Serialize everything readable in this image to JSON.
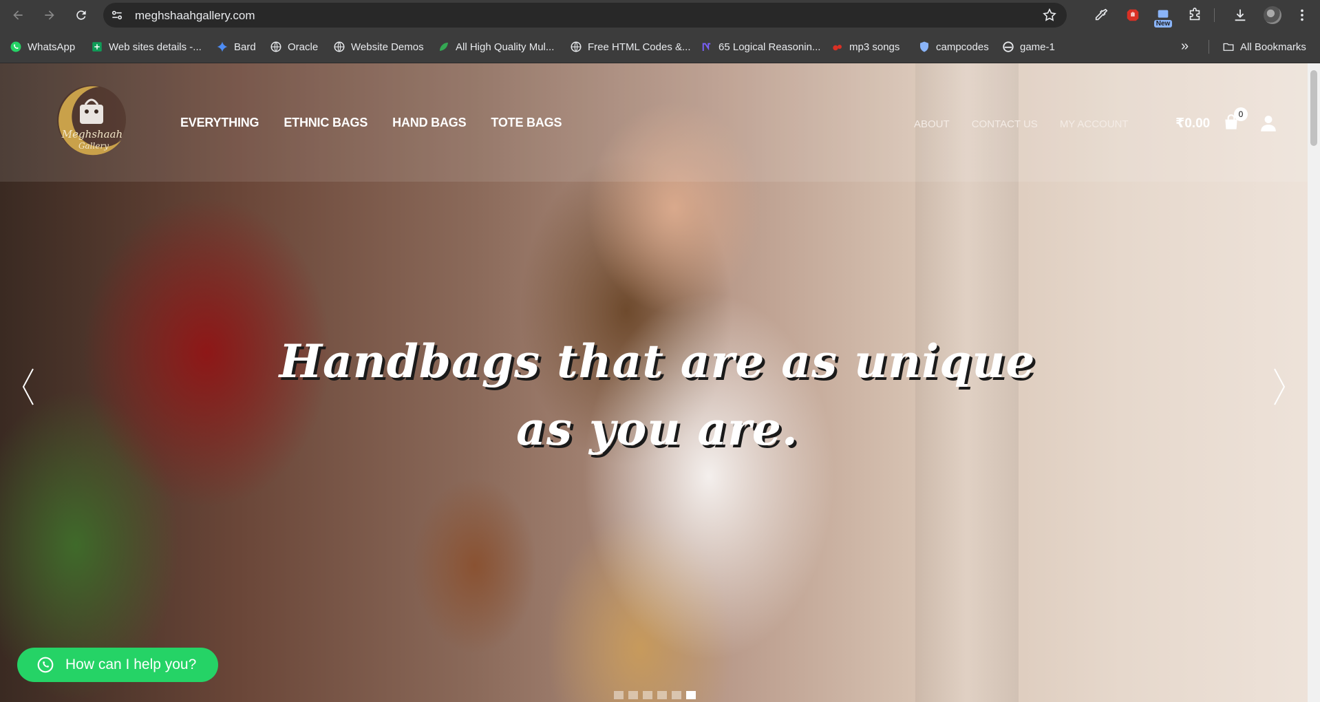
{
  "browser": {
    "url": "meghshaahgallery.com",
    "new_badge": "New",
    "bookmarks": [
      {
        "label": "WhatsApp",
        "icon": "whatsapp-icon"
      },
      {
        "label": "Web sites details -...",
        "icon": "sheets-icon"
      },
      {
        "label": "Bard",
        "icon": "bard-icon"
      },
      {
        "label": "Oracle",
        "icon": "globe-icon"
      },
      {
        "label": "Website Demos",
        "icon": "globe-icon"
      },
      {
        "label": "All High Quality Mul...",
        "icon": "leaf-icon"
      },
      {
        "label": "Free HTML Codes &...",
        "icon": "globe-icon"
      },
      {
        "label": "65 Logical Reasonin...",
        "icon": "n-icon"
      },
      {
        "label": "mp3 songs",
        "icon": "music-icon"
      },
      {
        "label": "campcodes",
        "icon": "shield-icon"
      },
      {
        "label": "game-1",
        "icon": "edge-icon"
      }
    ],
    "more_label": "»",
    "all_bookmarks": "All Bookmarks"
  },
  "site": {
    "logo_text": "Meghshaah Gallery",
    "main_nav": [
      "EVERYTHING",
      "ETHNIC BAGS",
      "HAND BAGS",
      "TOTE BAGS"
    ],
    "secondary_nav": [
      "ABOUT",
      "CONTACT US",
      "MY ACCOUNT"
    ],
    "cart_total": "₹0.00",
    "cart_count": "0"
  },
  "hero": {
    "caption_line1": "Handbags that are as unique",
    "caption_line2": "as you are.",
    "slide_count": 6,
    "active_slide": 6
  },
  "chat": {
    "label": "How can I help you?"
  },
  "colors": {
    "chrome": "#3c3c3c",
    "omnibox": "#282828",
    "whatsapp_green": "#25d366"
  }
}
